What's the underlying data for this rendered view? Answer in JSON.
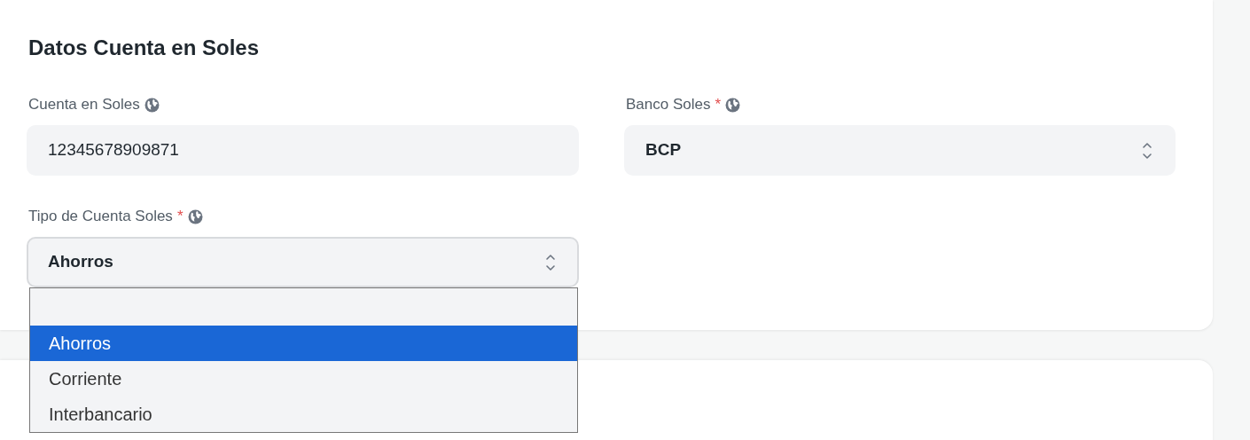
{
  "section": {
    "title": "Datos Cuenta en Soles"
  },
  "fields": [
    {
      "kind": "input",
      "label": "Cuenta en Soles",
      "value": "12345678909871",
      "focused": false
    },
    {
      "kind": "select",
      "label": "Banco Soles",
      "required_mark": "*",
      "value": "BCP",
      "focused": false
    },
    {
      "kind": "select",
      "label": "Tipo de Cuenta Soles",
      "required_mark": "*",
      "value": "Ahorros",
      "focused": true,
      "options": [
        {
          "kind": "option",
          "label": "Ahorros",
          "selected": true
        },
        {
          "kind": "option",
          "label": "Corriente",
          "selected": false
        },
        {
          "kind": "option",
          "label": "Interbancario",
          "selected": false
        }
      ]
    }
  ]
}
